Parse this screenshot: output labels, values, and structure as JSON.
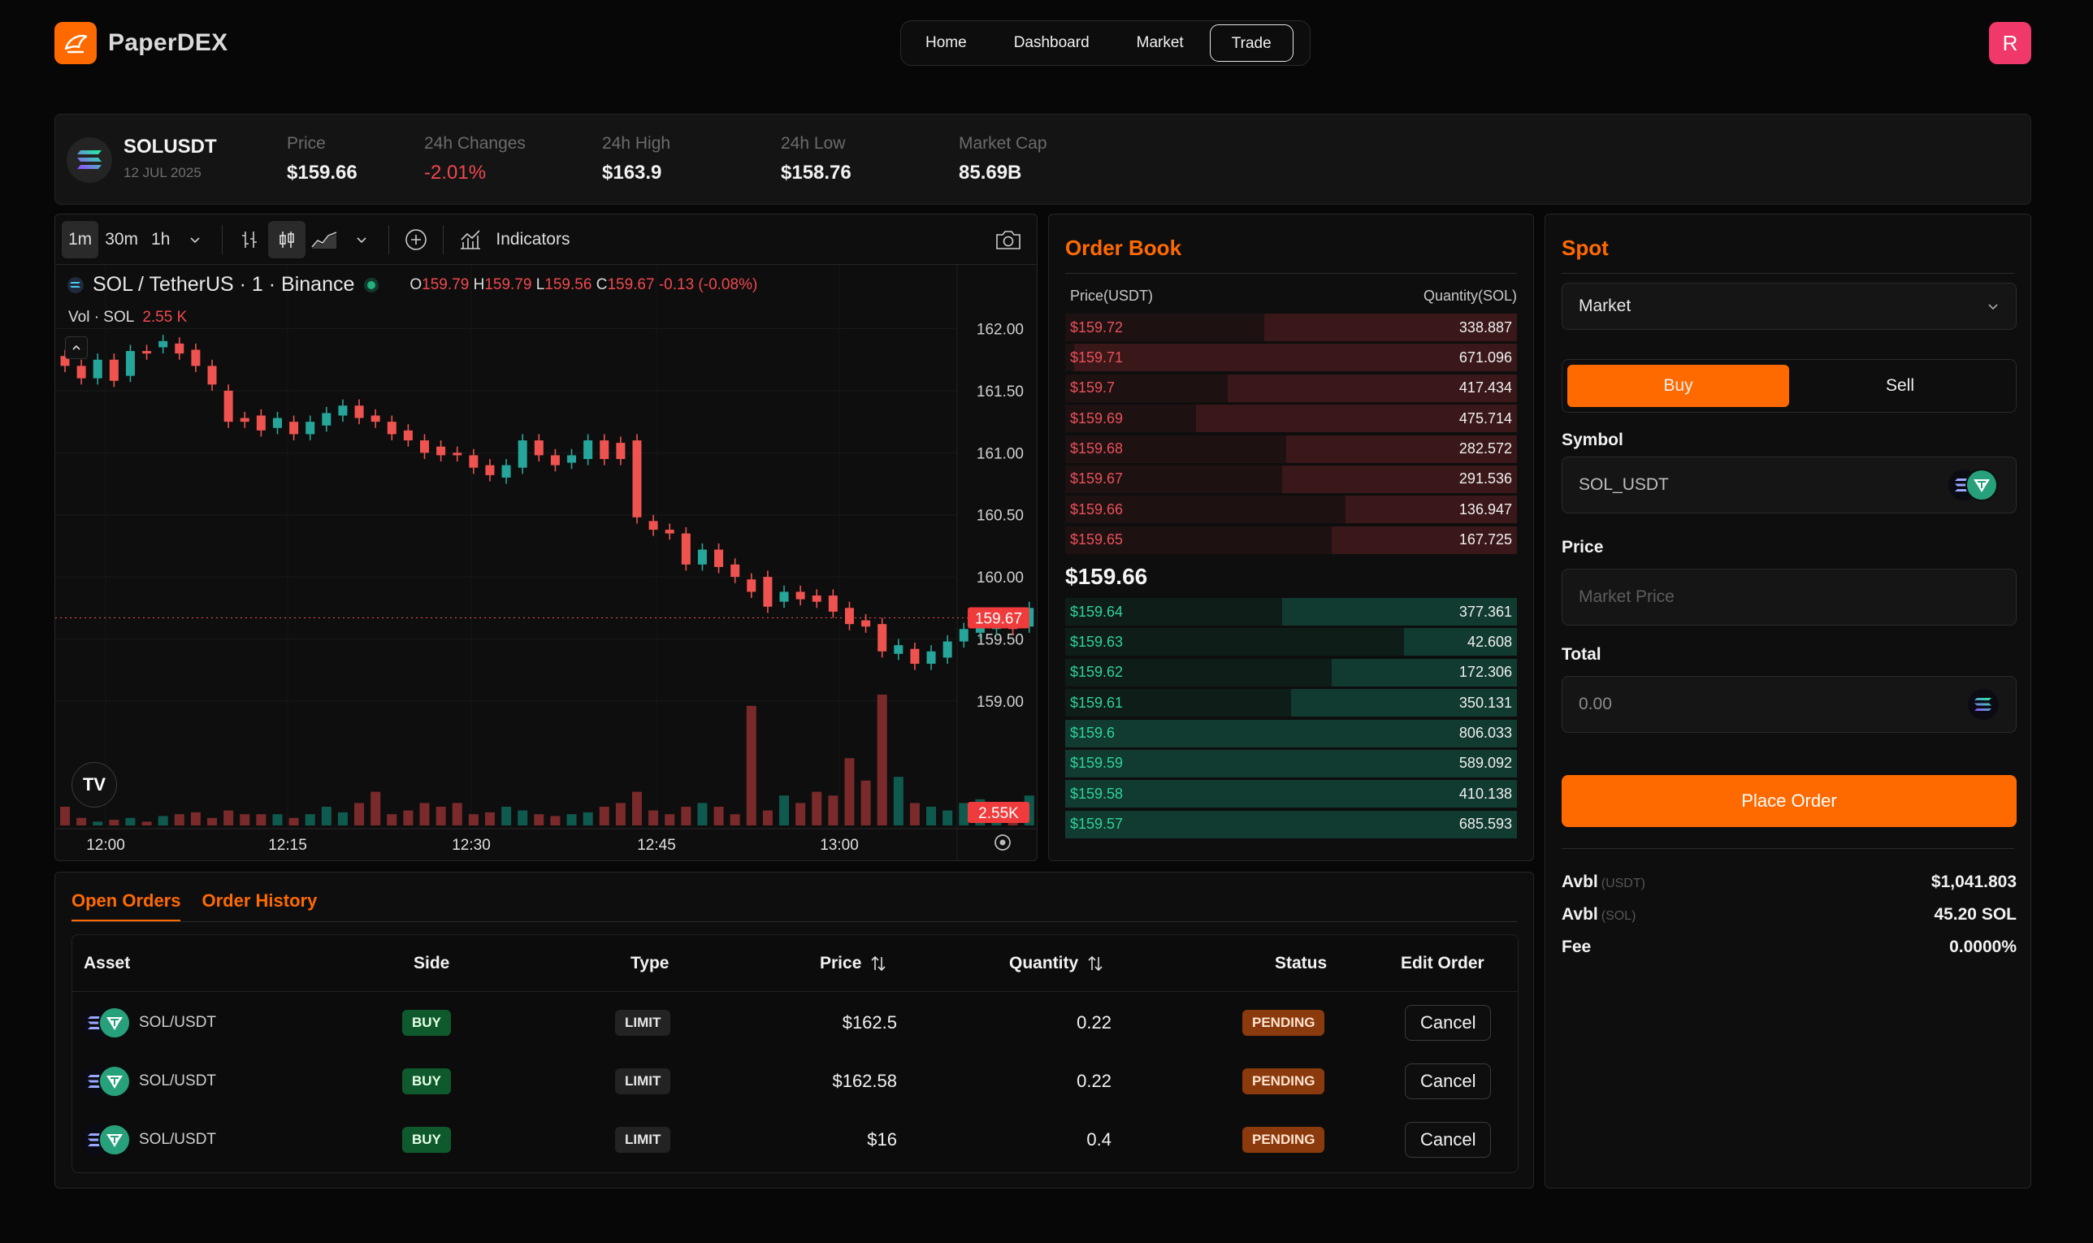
{
  "app": {
    "name": "PaperDEX",
    "avatar_initial": "R"
  },
  "nav": {
    "items": [
      "Home",
      "Dashboard",
      "Market",
      "Trade"
    ],
    "active": "Trade"
  },
  "ticker": {
    "symbol": "SOLUSDT",
    "date": "12 JUL 2025",
    "stats": [
      {
        "label": "Price",
        "value": "$159.66"
      },
      {
        "label": "24h Changes",
        "value": "-2.01%"
      },
      {
        "label": "24h High",
        "value": "$163.9"
      },
      {
        "label": "24h Low",
        "value": "$158.76"
      },
      {
        "label": "Market Cap",
        "value": "85.69B"
      }
    ]
  },
  "chart": {
    "toolbar": {
      "intervals": [
        "1m",
        "30m",
        "1h"
      ],
      "indicators_label": "Indicators"
    },
    "legend": {
      "title": "SOL / TetherUS · 1 · Binance",
      "o": "159.79",
      "h": "159.79",
      "l": "159.56",
      "c": "159.67",
      "change": "-0.13 (-0.08%)"
    },
    "volume_legend": {
      "label": "Vol · SOL",
      "value": "2.55 K"
    },
    "last_price_tag": "159.67",
    "volume_tag": "2.55K",
    "tv_logo": "TV"
  },
  "chart_data": {
    "type": "candlestick",
    "x_ticks": [
      "12:00",
      "12:15",
      "12:30",
      "12:45",
      "13:00"
    ],
    "y_ticks": [
      "162.00",
      "161.50",
      "161.00",
      "160.50",
      "160.00",
      "159.50",
      "159.00"
    ],
    "ylim": [
      158.6,
      162.2
    ],
    "last_price": 159.67,
    "candles": [
      [
        161.78,
        161.7
      ],
      [
        161.7,
        161.6
      ],
      [
        161.6,
        161.75
      ],
      [
        161.75,
        161.58
      ],
      [
        161.62,
        161.82
      ],
      [
        161.82,
        161.8
      ],
      [
        161.85,
        161.9
      ],
      [
        161.88,
        161.8
      ],
      [
        161.83,
        161.7
      ],
      [
        161.7,
        161.55
      ],
      [
        161.5,
        161.25
      ],
      [
        161.28,
        161.25
      ],
      [
        161.3,
        161.18
      ],
      [
        161.2,
        161.28
      ],
      [
        161.25,
        161.15
      ],
      [
        161.15,
        161.25
      ],
      [
        161.22,
        161.32
      ],
      [
        161.3,
        161.38
      ],
      [
        161.38,
        161.28
      ],
      [
        161.3,
        161.25
      ],
      [
        161.25,
        161.15
      ],
      [
        161.18,
        161.1
      ],
      [
        161.1,
        161.0
      ],
      [
        161.05,
        160.98
      ],
      [
        161.0,
        160.98
      ],
      [
        160.98,
        160.88
      ],
      [
        160.9,
        160.82
      ],
      [
        160.8,
        160.9
      ],
      [
        160.88,
        161.1
      ],
      [
        161.1,
        160.98
      ],
      [
        160.98,
        160.9
      ],
      [
        160.92,
        160.98
      ],
      [
        160.95,
        161.1
      ],
      [
        161.1,
        160.95
      ],
      [
        161.08,
        160.95
      ],
      [
        161.1,
        160.48
      ],
      [
        160.45,
        160.38
      ],
      [
        160.38,
        160.35
      ],
      [
        160.35,
        160.1
      ],
      [
        160.1,
        160.22
      ],
      [
        160.22,
        160.08
      ],
      [
        160.1,
        160.0
      ],
      [
        159.98,
        159.88
      ],
      [
        160.0,
        159.76
      ],
      [
        159.8,
        159.88
      ],
      [
        159.88,
        159.82
      ],
      [
        159.85,
        159.8
      ],
      [
        159.85,
        159.72
      ],
      [
        159.75,
        159.62
      ],
      [
        159.65,
        159.6
      ],
      [
        159.62,
        159.4
      ],
      [
        159.38,
        159.45
      ],
      [
        159.42,
        159.3
      ],
      [
        159.3,
        159.4
      ],
      [
        159.35,
        159.48
      ],
      [
        159.48,
        159.58
      ],
      [
        159.55,
        159.6
      ],
      [
        159.58,
        159.65
      ],
      [
        159.65,
        159.58
      ],
      [
        159.6,
        159.75
      ],
      [
        159.75,
        159.67
      ]
    ],
    "volumes": [
      0.5,
      0.2,
      0.1,
      0.15,
      0.2,
      0.1,
      0.25,
      0.3,
      0.35,
      0.2,
      0.4,
      0.3,
      0.3,
      0.3,
      0.2,
      0.3,
      0.5,
      0.35,
      0.6,
      0.9,
      0.3,
      0.4,
      0.6,
      0.5,
      0.6,
      0.3,
      0.35,
      0.5,
      0.4,
      0.3,
      0.25,
      0.3,
      0.35,
      0.5,
      0.6,
      0.9,
      0.4,
      0.3,
      0.5,
      0.6,
      0.5,
      0.3,
      3.2,
      0.4,
      0.8,
      0.6,
      0.9,
      0.8,
      1.8,
      1.2,
      3.5,
      1.3,
      0.6,
      0.5,
      0.4,
      0.6,
      0.7,
      0.4,
      0.2,
      0.8,
      0.3
    ]
  },
  "orderbook": {
    "title": "Order Book",
    "price_header": "Price(USDT)",
    "qty_header": "Quantity(SOL)",
    "mid_price": "$159.66",
    "asks": [
      {
        "price": "$159.72",
        "qty": "338.887",
        "depth": 0.56
      },
      {
        "price": "$159.71",
        "qty": "671.096",
        "depth": 0.98
      },
      {
        "price": "$159.7",
        "qty": "417.434",
        "depth": 0.64
      },
      {
        "price": "$159.69",
        "qty": "475.714",
        "depth": 0.71
      },
      {
        "price": "$159.68",
        "qty": "282.572",
        "depth": 0.51
      },
      {
        "price": "$159.67",
        "qty": "291.536",
        "depth": 0.52
      },
      {
        "price": "$159.66",
        "qty": "136.947",
        "depth": 0.38
      },
      {
        "price": "$159.65",
        "qty": "167.725",
        "depth": 0.41
      }
    ],
    "bids": [
      {
        "price": "$159.64",
        "qty": "377.361",
        "depth": 0.52
      },
      {
        "price": "$159.63",
        "qty": "42.608",
        "depth": 0.25
      },
      {
        "price": "$159.62",
        "qty": "172.306",
        "depth": 0.41
      },
      {
        "price": "$159.61",
        "qty": "350.131",
        "depth": 0.5
      },
      {
        "price": "$159.6",
        "qty": "806.033",
        "depth": 1.0
      },
      {
        "price": "$159.59",
        "qty": "589.092",
        "depth": 1.0
      },
      {
        "price": "$159.58",
        "qty": "410.138",
        "depth": 1.0
      },
      {
        "price": "$159.57",
        "qty": "685.593",
        "depth": 1.0
      }
    ]
  },
  "spot": {
    "title": "Spot",
    "order_type": "Market",
    "buy_label": "Buy",
    "sell_label": "Sell",
    "symbol_label": "Symbol",
    "symbol_value": "SOL_USDT",
    "price_label": "Price",
    "price_placeholder": "Market Price",
    "total_label": "Total",
    "total_value": "0.00",
    "place_order_label": "Place Order",
    "avbl_usdt_label": "Avbl",
    "avbl_usdt_unit": "(USDT)",
    "avbl_usdt_value": "$1,041.803",
    "avbl_sol_label": "Avbl",
    "avbl_sol_unit": "(SOL)",
    "avbl_sol_value": "45.20 SOL",
    "fee_label": "Fee",
    "fee_value": "0.0000%"
  },
  "orders": {
    "tabs": [
      "Open Orders",
      "Order History"
    ],
    "headers": {
      "asset": "Asset",
      "side": "Side",
      "type": "Type",
      "price": "Price",
      "quantity": "Quantity",
      "status": "Status",
      "edit": "Edit Order"
    },
    "rows": [
      {
        "asset": "SOL/USDT",
        "side": "BUY",
        "type": "LIMIT",
        "price": "$162.5",
        "quantity": "0.22",
        "status": "PENDING",
        "action": "Cancel"
      },
      {
        "asset": "SOL/USDT",
        "side": "BUY",
        "type": "LIMIT",
        "price": "$162.58",
        "quantity": "0.22",
        "status": "PENDING",
        "action": "Cancel"
      },
      {
        "asset": "SOL/USDT",
        "side": "BUY",
        "type": "LIMIT",
        "price": "$16",
        "quantity": "0.4",
        "status": "PENDING",
        "action": "Cancel"
      }
    ]
  },
  "colors": {
    "accent": "#ff6a00",
    "up": "#26a69a",
    "down": "#ef5350",
    "avatar": "#f0386b"
  }
}
